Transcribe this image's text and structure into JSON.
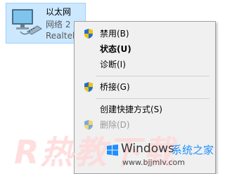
{
  "adapter": {
    "name": "以太网",
    "network": "网络 2",
    "device": "Realtek"
  },
  "menu": {
    "items": [
      {
        "label": "禁用(B)",
        "icon": "uac-shield-icon",
        "bold": false,
        "disabled": false
      },
      {
        "label": "状态(U)",
        "icon": null,
        "bold": true,
        "disabled": false
      },
      {
        "label": "诊断(I)",
        "icon": null,
        "bold": false,
        "disabled": false
      },
      {
        "label": "桥接(G)",
        "icon": "uac-shield-icon",
        "bold": false,
        "disabled": false
      },
      {
        "label": "创建快捷方式(S)",
        "icon": null,
        "bold": false,
        "disabled": false
      },
      {
        "label": "删除(D)",
        "icon": "uac-shield-icon",
        "bold": false,
        "disabled": true
      }
    ]
  },
  "watermark": {
    "text": "R热教下载",
    "brand_os": "Windows",
    "brand_tagline": "系统之家",
    "brand_url": "www.bjjmlv.com"
  },
  "colors": {
    "selection_bg": "#cce8ff",
    "selection_border": "#99d1ff",
    "menu_bg": "#f0f0f0",
    "disabled_text": "#9a9a9a",
    "brand_blue": "#1e8fff"
  }
}
